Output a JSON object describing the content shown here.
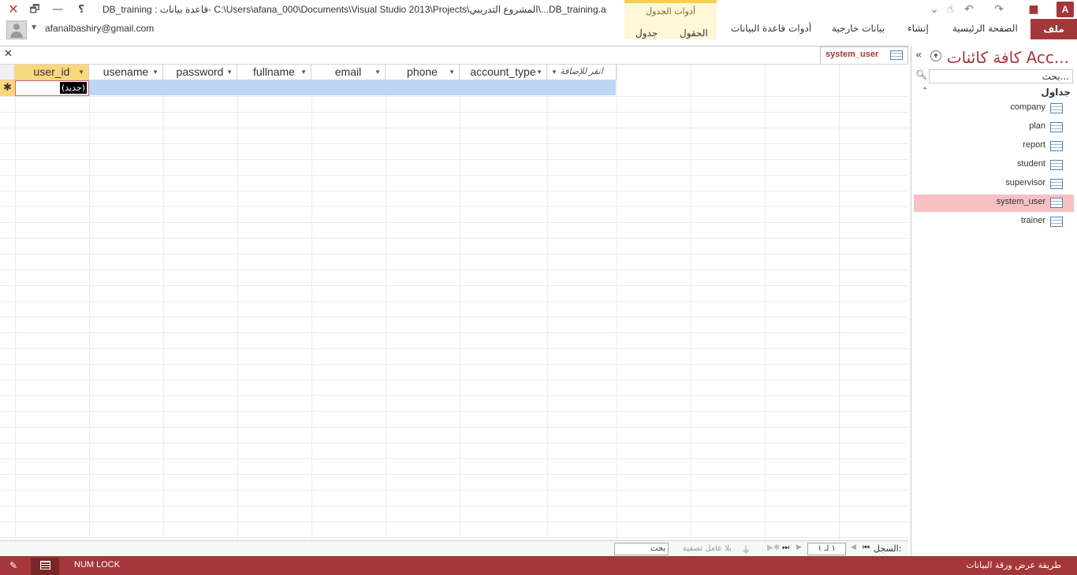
{
  "window": {
    "title": "DB_training : قاعدة بيانات- C:\\Users\\afana_000\\Documents\\Visual Studio 2013\\Projects\\المشروع التدريبي\\...DB_training.a",
    "close_glyph": "✕",
    "restore_glyph": "🗗",
    "minimize_glyph": "—",
    "help_glyph": "؟"
  },
  "quick_access": {
    "logo_text": "A",
    "icons": [
      "customize-icon",
      "touch-mode-icon",
      "undo-icon",
      "redo-icon",
      "save-icon"
    ]
  },
  "account": {
    "email": "afanalbashiry@gmail.com"
  },
  "ribbon": {
    "file_tab": "ملف",
    "tabs": [
      "الصفحة الرئيسية",
      "إنشاء",
      "بيانات خارجية",
      "أدوات قاعدة البيانات"
    ],
    "context_group": {
      "label": "أدوات الجدول",
      "tabs": [
        "الحقول",
        "جدول"
      ]
    }
  },
  "document": {
    "tab_label": "system_user",
    "close_glyph": "✕"
  },
  "grid": {
    "columns": [
      {
        "label": "user_id",
        "active": true
      },
      {
        "label": "usename",
        "active": false
      },
      {
        "label": "password",
        "active": false
      },
      {
        "label": "fullname",
        "active": false
      },
      {
        "label": "email",
        "active": false
      },
      {
        "label": "phone",
        "active": false
      },
      {
        "label": "account_type",
        "active": false
      }
    ],
    "add_column_label": "انقر للإضافة",
    "new_row_marker": "✱",
    "new_row_placeholder": "(جديد)"
  },
  "record_nav": {
    "record_label": "السجل:",
    "position_text": "١ لـ ١",
    "filter_text": "بلا عامل تصفية",
    "search_text": "بحث"
  },
  "nav_pane": {
    "title": "كافة كائنات Acc...",
    "search_placeholder": "بحث...",
    "group_label": "جداول",
    "items": [
      {
        "label": "company",
        "selected": false
      },
      {
        "label": "plan",
        "selected": false
      },
      {
        "label": "report",
        "selected": false
      },
      {
        "label": "student",
        "selected": false
      },
      {
        "label": "supervisor",
        "selected": false
      },
      {
        "label": "system_user",
        "selected": true
      },
      {
        "label": "trainer",
        "selected": false
      }
    ]
  },
  "status_bar": {
    "view_label": "طريقة عرض ورقة البيانات",
    "numlock": "NUM LOCK"
  },
  "colors": {
    "brand": "#a4373a",
    "selection": "#f7c0c3",
    "active_header": "#fbd77b",
    "new_row_band": "#bcd6f5",
    "context_tab": "#fef7d9"
  }
}
